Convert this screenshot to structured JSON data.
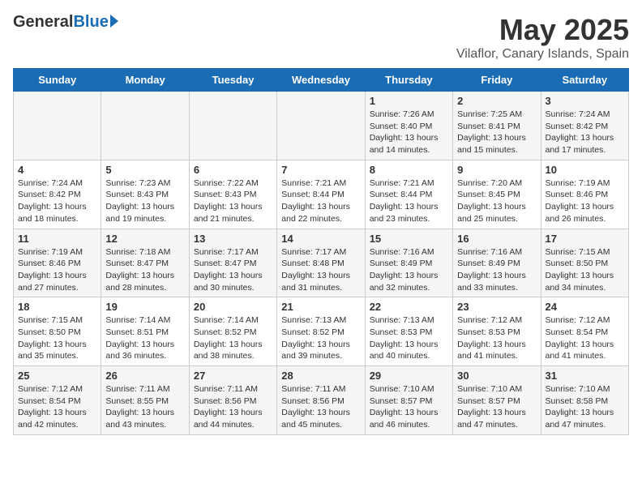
{
  "logo": {
    "general": "General",
    "blue": "Blue"
  },
  "title": "May 2025",
  "location": "Vilaflor, Canary Islands, Spain",
  "days_of_week": [
    "Sunday",
    "Monday",
    "Tuesday",
    "Wednesday",
    "Thursday",
    "Friday",
    "Saturday"
  ],
  "weeks": [
    [
      {
        "day": "",
        "info": ""
      },
      {
        "day": "",
        "info": ""
      },
      {
        "day": "",
        "info": ""
      },
      {
        "day": "",
        "info": ""
      },
      {
        "day": "1",
        "info": "Sunrise: 7:26 AM\nSunset: 8:40 PM\nDaylight: 13 hours\nand 14 minutes."
      },
      {
        "day": "2",
        "info": "Sunrise: 7:25 AM\nSunset: 8:41 PM\nDaylight: 13 hours\nand 15 minutes."
      },
      {
        "day": "3",
        "info": "Sunrise: 7:24 AM\nSunset: 8:42 PM\nDaylight: 13 hours\nand 17 minutes."
      }
    ],
    [
      {
        "day": "4",
        "info": "Sunrise: 7:24 AM\nSunset: 8:42 PM\nDaylight: 13 hours\nand 18 minutes."
      },
      {
        "day": "5",
        "info": "Sunrise: 7:23 AM\nSunset: 8:43 PM\nDaylight: 13 hours\nand 19 minutes."
      },
      {
        "day": "6",
        "info": "Sunrise: 7:22 AM\nSunset: 8:43 PM\nDaylight: 13 hours\nand 21 minutes."
      },
      {
        "day": "7",
        "info": "Sunrise: 7:21 AM\nSunset: 8:44 PM\nDaylight: 13 hours\nand 22 minutes."
      },
      {
        "day": "8",
        "info": "Sunrise: 7:21 AM\nSunset: 8:44 PM\nDaylight: 13 hours\nand 23 minutes."
      },
      {
        "day": "9",
        "info": "Sunrise: 7:20 AM\nSunset: 8:45 PM\nDaylight: 13 hours\nand 25 minutes."
      },
      {
        "day": "10",
        "info": "Sunrise: 7:19 AM\nSunset: 8:46 PM\nDaylight: 13 hours\nand 26 minutes."
      }
    ],
    [
      {
        "day": "11",
        "info": "Sunrise: 7:19 AM\nSunset: 8:46 PM\nDaylight: 13 hours\nand 27 minutes."
      },
      {
        "day": "12",
        "info": "Sunrise: 7:18 AM\nSunset: 8:47 PM\nDaylight: 13 hours\nand 28 minutes."
      },
      {
        "day": "13",
        "info": "Sunrise: 7:17 AM\nSunset: 8:47 PM\nDaylight: 13 hours\nand 30 minutes."
      },
      {
        "day": "14",
        "info": "Sunrise: 7:17 AM\nSunset: 8:48 PM\nDaylight: 13 hours\nand 31 minutes."
      },
      {
        "day": "15",
        "info": "Sunrise: 7:16 AM\nSunset: 8:49 PM\nDaylight: 13 hours\nand 32 minutes."
      },
      {
        "day": "16",
        "info": "Sunrise: 7:16 AM\nSunset: 8:49 PM\nDaylight: 13 hours\nand 33 minutes."
      },
      {
        "day": "17",
        "info": "Sunrise: 7:15 AM\nSunset: 8:50 PM\nDaylight: 13 hours\nand 34 minutes."
      }
    ],
    [
      {
        "day": "18",
        "info": "Sunrise: 7:15 AM\nSunset: 8:50 PM\nDaylight: 13 hours\nand 35 minutes."
      },
      {
        "day": "19",
        "info": "Sunrise: 7:14 AM\nSunset: 8:51 PM\nDaylight: 13 hours\nand 36 minutes."
      },
      {
        "day": "20",
        "info": "Sunrise: 7:14 AM\nSunset: 8:52 PM\nDaylight: 13 hours\nand 38 minutes."
      },
      {
        "day": "21",
        "info": "Sunrise: 7:13 AM\nSunset: 8:52 PM\nDaylight: 13 hours\nand 39 minutes."
      },
      {
        "day": "22",
        "info": "Sunrise: 7:13 AM\nSunset: 8:53 PM\nDaylight: 13 hours\nand 40 minutes."
      },
      {
        "day": "23",
        "info": "Sunrise: 7:12 AM\nSunset: 8:53 PM\nDaylight: 13 hours\nand 41 minutes."
      },
      {
        "day": "24",
        "info": "Sunrise: 7:12 AM\nSunset: 8:54 PM\nDaylight: 13 hours\nand 41 minutes."
      }
    ],
    [
      {
        "day": "25",
        "info": "Sunrise: 7:12 AM\nSunset: 8:54 PM\nDaylight: 13 hours\nand 42 minutes."
      },
      {
        "day": "26",
        "info": "Sunrise: 7:11 AM\nSunset: 8:55 PM\nDaylight: 13 hours\nand 43 minutes."
      },
      {
        "day": "27",
        "info": "Sunrise: 7:11 AM\nSunset: 8:56 PM\nDaylight: 13 hours\nand 44 minutes."
      },
      {
        "day": "28",
        "info": "Sunrise: 7:11 AM\nSunset: 8:56 PM\nDaylight: 13 hours\nand 45 minutes."
      },
      {
        "day": "29",
        "info": "Sunrise: 7:10 AM\nSunset: 8:57 PM\nDaylight: 13 hours\nand 46 minutes."
      },
      {
        "day": "30",
        "info": "Sunrise: 7:10 AM\nSunset: 8:57 PM\nDaylight: 13 hours\nand 47 minutes."
      },
      {
        "day": "31",
        "info": "Sunrise: 7:10 AM\nSunset: 8:58 PM\nDaylight: 13 hours\nand 47 minutes."
      }
    ]
  ]
}
